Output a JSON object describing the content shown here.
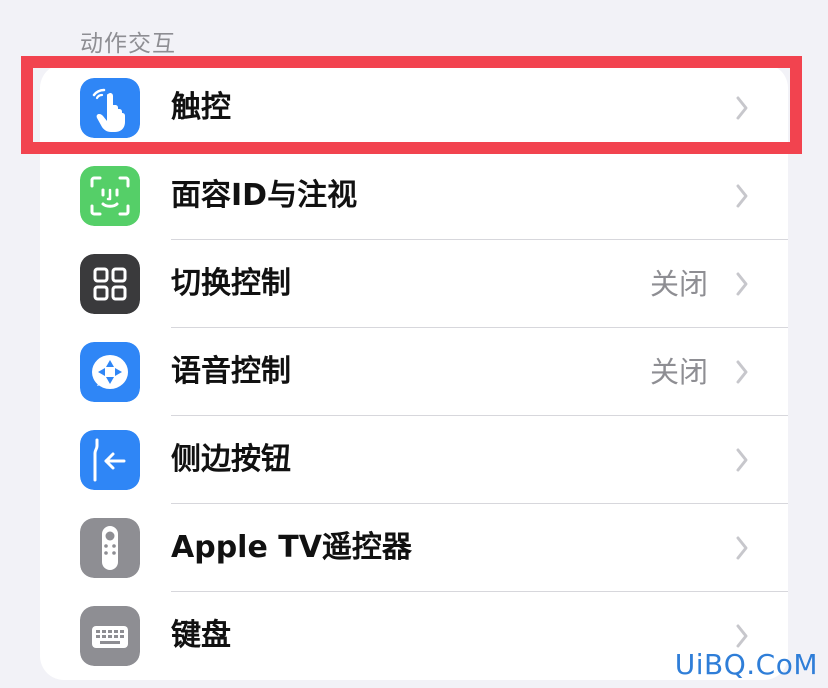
{
  "section": {
    "title": "动作交互"
  },
  "rows": [
    {
      "label": "触控",
      "value": "",
      "icon_name": "hand-touch-icon",
      "icon_bg": "#2f86f6"
    },
    {
      "label": "面容ID与注视",
      "value": "",
      "icon_name": "face-id-icon",
      "icon_bg": "#55cf68"
    },
    {
      "label": "切换控制",
      "value": "关闭",
      "icon_name": "switch-control-icon",
      "icon_bg": "#3a3a3c"
    },
    {
      "label": "语音控制",
      "value": "关闭",
      "icon_name": "voice-control-icon",
      "icon_bg": "#2f86f6"
    },
    {
      "label": "侧边按钮",
      "value": "",
      "icon_name": "side-button-icon",
      "icon_bg": "#2f86f6"
    },
    {
      "label": "Apple TV遥控器",
      "value": "",
      "icon_name": "apple-tv-remote-icon",
      "icon_bg": "#8e8e93"
    },
    {
      "label": "键盘",
      "value": "",
      "icon_name": "keyboard-icon",
      "icon_bg": "#8e8e93"
    }
  ],
  "highlight": {
    "color": "#f2434f"
  },
  "watermark": {
    "text": "UiBQ.CoM"
  }
}
